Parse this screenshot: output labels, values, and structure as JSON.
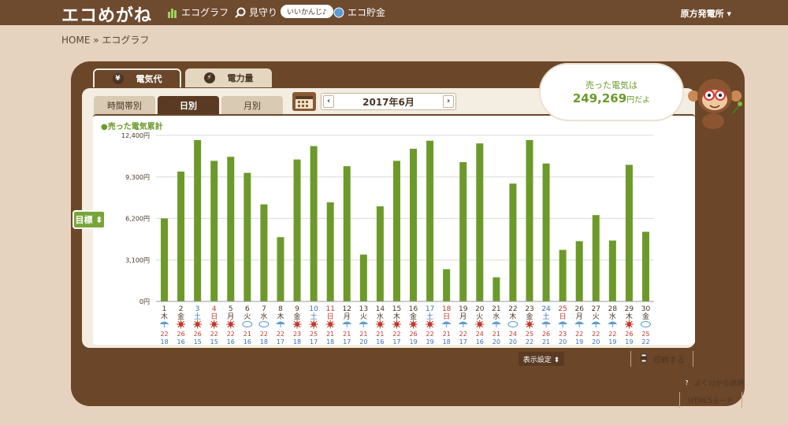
{
  "header": {
    "logo": "エコめがね",
    "nav_ecograph": "エコグラフ",
    "nav_watch": "見守り",
    "bubble": "いいかんじ♪",
    "nav_savings": "エコ貯金",
    "plant": "原方発電所 ▾"
  },
  "breadcrumb": "HOME » エコグラフ",
  "tabs": {
    "elec_cost": "電気代",
    "elec_amount": "電力量",
    "elec_icon": "¥",
    "power_icon": "⚡"
  },
  "subtabs": {
    "hourly": "時間帯別",
    "daily": "日別",
    "monthly": "月別"
  },
  "month_nav": {
    "prev": "‹",
    "label": "2017年6月",
    "next": "›"
  },
  "legend": "●売った電気累計",
  "speech": {
    "line1": "売った電気は",
    "value": "249,269",
    "unit": "円だよ"
  },
  "target_button": "目標 ⬍",
  "display_settings": "表示設定 ⬍",
  "print": "印刷する",
  "help": "よくわかる説明",
  "html5": "HTML5モード",
  "colors": {
    "bar": "#6c9a2a",
    "saturday": "#3a6fb7",
    "sunday": "#c0392b",
    "weekday": "#4a3525"
  },
  "chart_data": {
    "type": "bar",
    "title": "●売った電気累計",
    "ylim": [
      0,
      12400
    ],
    "yticks": [
      "0円",
      "3,100円",
      "6,200円",
      "9,300円",
      "12,400円"
    ],
    "ytick_values": [
      0,
      3100,
      6200,
      9300,
      12400
    ],
    "grid": true,
    "categories": [
      "1",
      "2",
      "3",
      "4",
      "5",
      "6",
      "7",
      "8",
      "9",
      "10",
      "11",
      "12",
      "13",
      "14",
      "15",
      "16",
      "17",
      "18",
      "19",
      "20",
      "21",
      "22",
      "23",
      "24",
      "25",
      "26",
      "27",
      "28",
      "29",
      "30"
    ],
    "weekdays": [
      "木",
      "金",
      "土",
      "日",
      "月",
      "火",
      "水",
      "木",
      "金",
      "土",
      "日",
      "月",
      "火",
      "水",
      "木",
      "金",
      "土",
      "日",
      "月",
      "火",
      "水",
      "木",
      "金",
      "土",
      "日",
      "月",
      "火",
      "水",
      "木",
      "金"
    ],
    "weather": [
      "rain",
      "sun",
      "sun",
      "sun",
      "sun",
      "cloud",
      "cloud",
      "rain",
      "sun",
      "sun",
      "sun",
      "rain",
      "rain",
      "sun",
      "sun",
      "sun",
      "sun",
      "rain",
      "rain",
      "sun",
      "rain",
      "cloud",
      "sun",
      "rain",
      "rain",
      "rain",
      "rain",
      "rain",
      "sun",
      "cloud"
    ],
    "temp_high": [
      "22",
      "26",
      "26",
      "22",
      "22",
      "21",
      "22",
      "22",
      "23",
      "25",
      "21",
      "21",
      "21",
      "21",
      "22",
      "26",
      "22",
      "21",
      "22",
      "24",
      "21",
      "24",
      "25",
      "26",
      "23",
      "22",
      "22",
      "22",
      "26",
      "25"
    ],
    "temp_low": [
      "18",
      "16",
      "15",
      "15",
      "16",
      "16",
      "18",
      "17",
      "18",
      "17",
      "18",
      "17",
      "20",
      "16",
      "17",
      "19",
      "19",
      "18",
      "17",
      "16",
      "20",
      "20",
      "22",
      "21",
      "20",
      "19",
      "20",
      "19",
      "19",
      "22"
    ],
    "series": [
      {
        "values": [
          6200,
          9700,
          12050,
          10500,
          10800,
          9600,
          7250,
          4800,
          10600,
          11600,
          7400,
          10100,
          3500,
          7100,
          10500,
          11400,
          12000,
          2400,
          10400,
          11800,
          1800,
          8800,
          12050,
          10300,
          3850,
          4500,
          6450,
          4550,
          10200,
          5200
        ]
      }
    ]
  }
}
